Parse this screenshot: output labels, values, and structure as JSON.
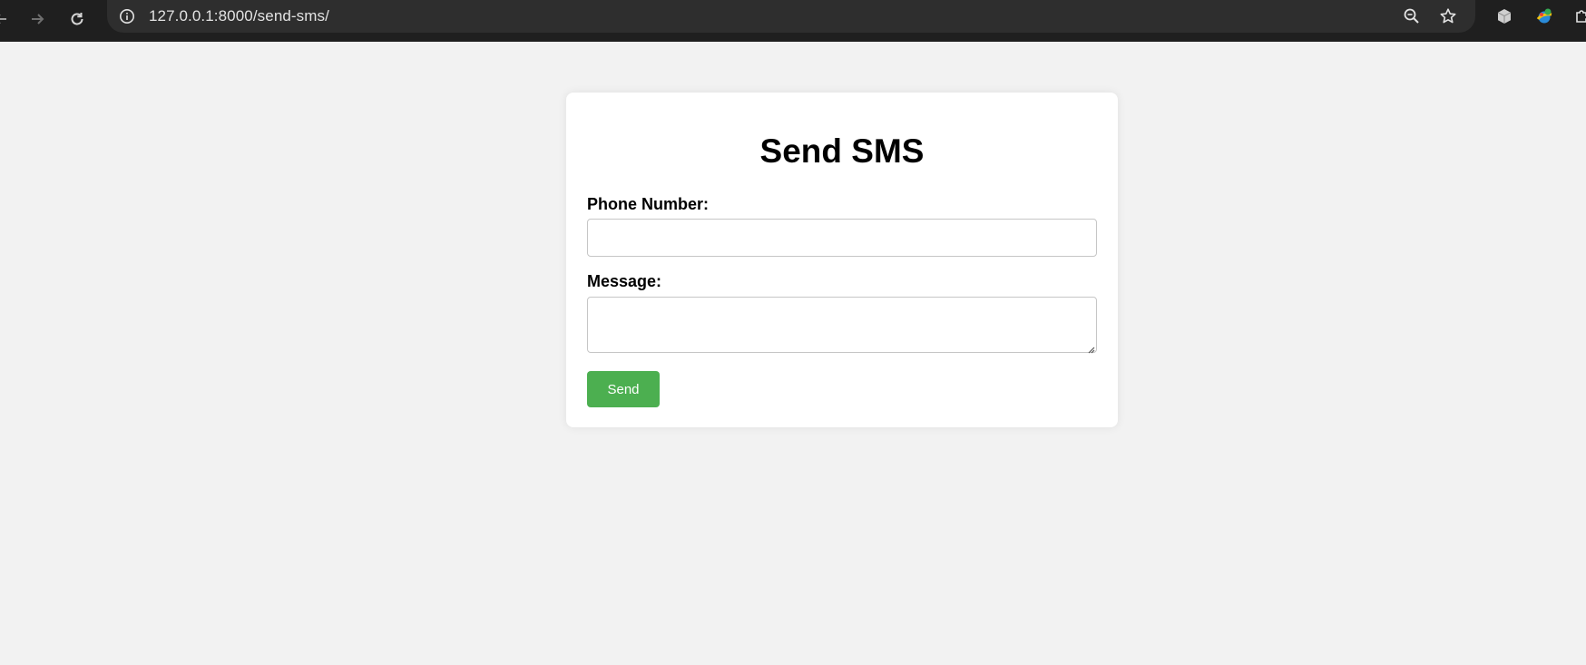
{
  "browser": {
    "url": "127.0.0.1:8000/send-sms/",
    "icons": {
      "back": "back-arrow-icon",
      "forward": "forward-arrow-icon",
      "reload": "reload-icon",
      "site_info": "info-icon",
      "zoom": "zoom-out-icon",
      "bookmark": "star-icon",
      "extension_1": "cube-extension-icon",
      "extension_2": "colorful-extension-icon",
      "extensions_menu": "puzzle-icon"
    }
  },
  "form": {
    "title": "Send SMS",
    "phone_label": "Phone Number:",
    "phone_value": "",
    "message_label": "Message:",
    "message_value": "",
    "send_label": "Send"
  },
  "colors": {
    "page_background": "#f2f2f2",
    "card_background": "#ffffff",
    "button": "#4caf50",
    "button_text": "#ffffff",
    "chrome": "#1f1f1f",
    "omnibox": "#2e2e2e"
  }
}
